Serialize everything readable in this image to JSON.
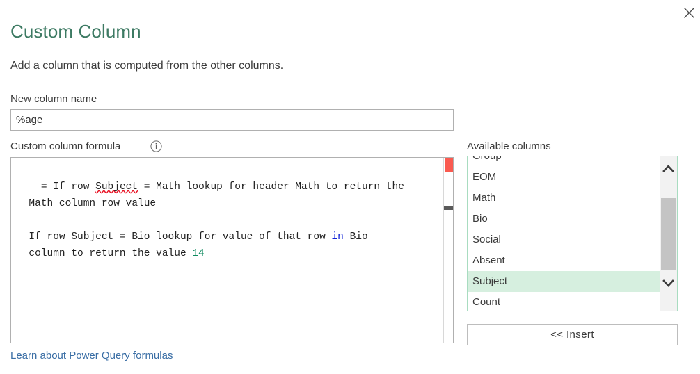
{
  "dialog": {
    "title": "Custom Column",
    "subtitle": "Add a column that is computed from the other columns.",
    "close_label": "Close"
  },
  "new_column": {
    "label": "New column name",
    "value": "%age",
    "placeholder": ""
  },
  "formula": {
    "label": "Custom column formula",
    "info_icon": "info-icon",
    "lines": [
      "= If row Subject = Math lookup for header Math to return the Math column row value",
      "",
      "If row Subject = Bio lookup for value of that row in Bio column to return the value 14"
    ],
    "segments": [
      {
        "text": "= If row ",
        "style": "plain"
      },
      {
        "text": "Subject",
        "style": "misspelled"
      },
      {
        "text": " = Math lookup for header Math to return the\n  Math column row value\n\n  If row Subject = Bio lookup for value of that row ",
        "style": "plain"
      },
      {
        "text": "in",
        "style": "keyword"
      },
      {
        "text": " Bio\n  column to return the value ",
        "style": "plain"
      },
      {
        "text": "14",
        "style": "number"
      }
    ],
    "error_marker": "error-marker",
    "colors": {
      "keyword": "#0f22d6",
      "number": "#0f8a5f",
      "error": "#fa5a50",
      "squiggle": "#e81123"
    }
  },
  "available_columns": {
    "label": "Available columns",
    "items": [
      {
        "name": "Group",
        "selected": false
      },
      {
        "name": "EOM",
        "selected": false
      },
      {
        "name": "Math",
        "selected": false
      },
      {
        "name": "Bio",
        "selected": false
      },
      {
        "name": "Social",
        "selected": false
      },
      {
        "name": "Absent",
        "selected": false
      },
      {
        "name": "Subject",
        "selected": true
      },
      {
        "name": "Count",
        "selected": false
      }
    ],
    "scroll_up_icon": "chevron-up-icon",
    "scroll_down_icon": "chevron-down-icon"
  },
  "insert_button": {
    "label": "<< Insert"
  },
  "learn_link": {
    "label": "Learn about Power Query formulas"
  },
  "theme": {
    "title_color": "#3d7a63",
    "link_color": "#3a6ea5",
    "selection_green": "#d6efdf",
    "list_border_green": "#a8dcc0"
  }
}
